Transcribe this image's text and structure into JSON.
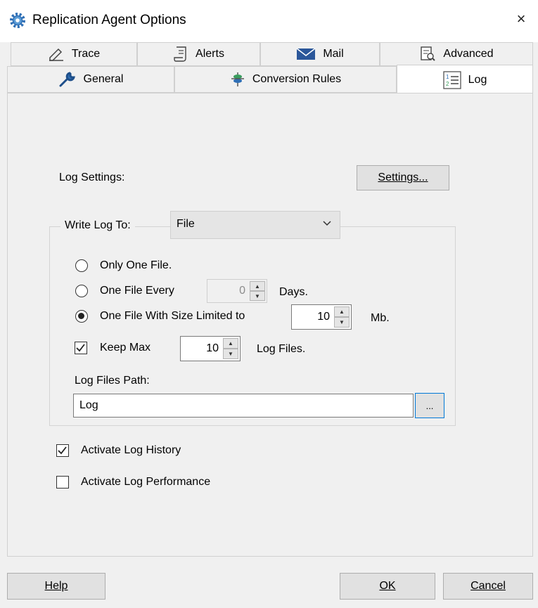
{
  "window": {
    "title": "Replication Agent Options",
    "close_glyph": "×",
    "icon": "gear-icon"
  },
  "tabs": {
    "row1": [
      {
        "label": "Trace",
        "icon": "pencil-icon"
      },
      {
        "label": "Alerts",
        "icon": "script-icon"
      },
      {
        "label": "Mail",
        "icon": "envelope-icon"
      },
      {
        "label": "Advanced",
        "icon": "document-search-icon"
      }
    ],
    "row2": [
      {
        "label": "General",
        "icon": "wrench-icon"
      },
      {
        "label": "Conversion Rules",
        "icon": "conversion-icon"
      },
      {
        "label": "Log",
        "icon": "numbered-list-icon",
        "active": true
      }
    ]
  },
  "log": {
    "settings_label": "Log Settings:",
    "settings_button": "Settings...",
    "write_log_to_label": "Write Log To:",
    "write_log_to_value": "File",
    "radio_only_one_file": "Only One File.",
    "radio_one_file_every": "One File Every",
    "days_value": "0",
    "days_label": "Days.",
    "radio_size_limited": "One File With Size Limited to",
    "size_value": "10",
    "size_unit": "Mb.",
    "selected_option": "size_limited",
    "keep_max_label": "Keep Max",
    "keep_max_checked": true,
    "keep_max_value": "10",
    "log_files_label": "Log Files.",
    "path_label": "Log Files Path:",
    "path_value": "Log",
    "browse_button": "...",
    "activate_history_label": "Activate Log History",
    "activate_history_checked": true,
    "activate_performance_label": "Activate Log Performance",
    "activate_performance_checked": false
  },
  "footer": {
    "help": "Help",
    "ok": "OK",
    "cancel": "Cancel"
  },
  "colors": {
    "active_tab": "#ffffff",
    "panel": "#f0f0f0",
    "browse_border": "#0078d7",
    "mail_icon": "#2b579a"
  }
}
